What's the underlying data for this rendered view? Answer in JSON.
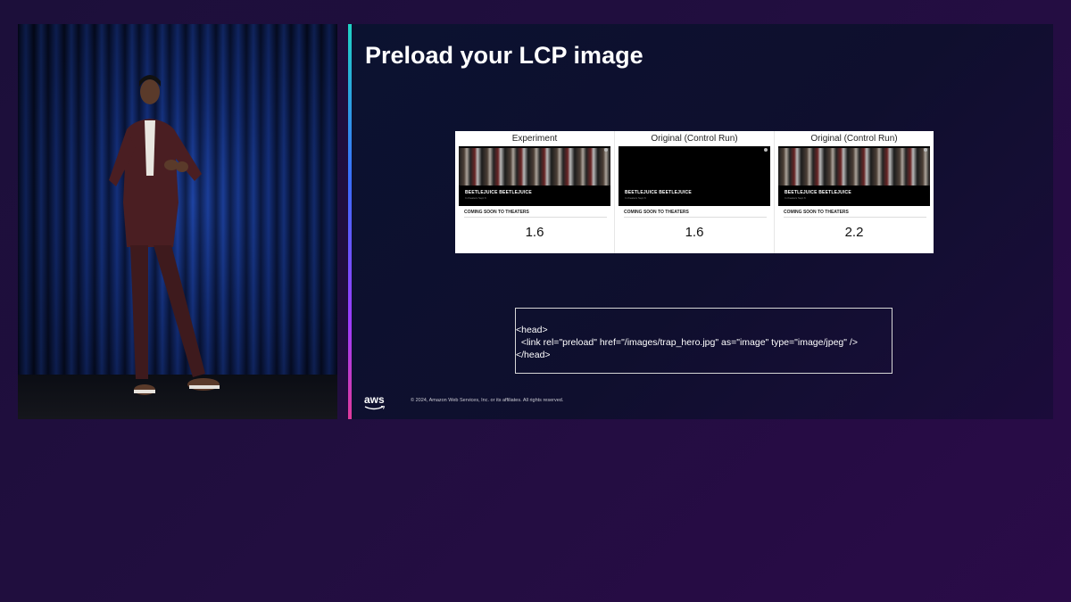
{
  "slide": {
    "title": "Preload your LCP image",
    "comparison": [
      {
        "header": "Experiment",
        "thumb_title": "BEETLEJUICE BEETLEJUICE",
        "thumb_sub": "In theaters Sept 6",
        "caption": "COMING SOON TO THEATERS",
        "value": "1.6",
        "shows_image": true
      },
      {
        "header": "Original (Control Run)",
        "thumb_title": "BEETLEJUICE BEETLEJUICE",
        "thumb_sub": "In theaters Sept 6",
        "caption": "COMING SOON TO THEATERS",
        "value": "1.6",
        "shows_image": false
      },
      {
        "header": "Original (Control Run)",
        "thumb_title": "BEETLEJUICE BEETLEJUICE",
        "thumb_sub": "In theaters Sept 6",
        "caption": "COMING SOON TO THEATERS",
        "value": "2.2",
        "shows_image": true
      }
    ],
    "code_lines": [
      "<head>",
      "  <link rel=\"preload\" href=\"/images/trap_hero.jpg\" as=\"image\" type=\"image/jpeg\" />",
      "</head>"
    ],
    "logo_text": "aws",
    "copyright": "© 2024, Amazon Web Services, Inc. or its affiliates. All rights reserved."
  },
  "colors": {
    "background": "#210e3f",
    "slide_bg": "#0f0f2e",
    "accent_top": "#1fd3c4",
    "accent_bottom": "#e03a9a",
    "text": "#ffffff"
  }
}
